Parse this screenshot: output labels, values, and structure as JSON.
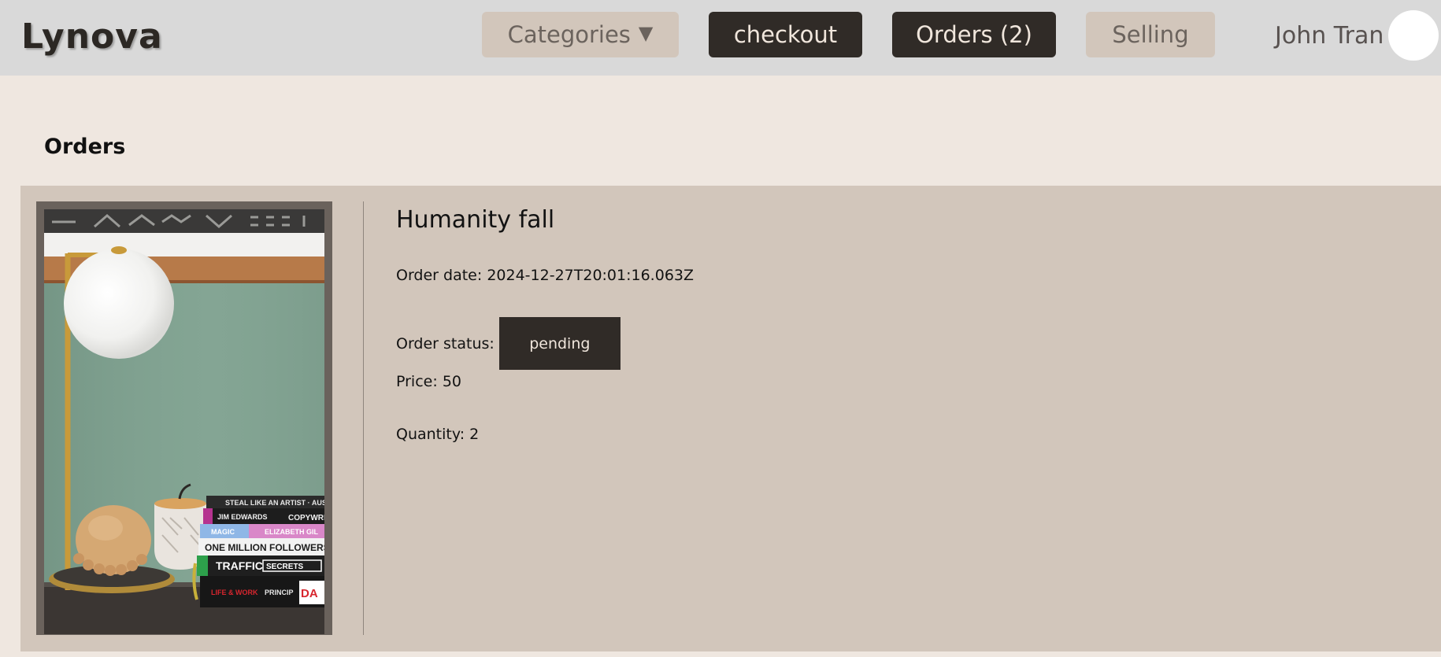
{
  "header": {
    "brand": "Lynova",
    "nav": {
      "categories_label": "Categories",
      "categories_caret": "▼",
      "checkout_label": "checkout",
      "orders_label": "Orders (2)",
      "selling_label": "Selling"
    },
    "user_name": "John Tran"
  },
  "main": {
    "title": "Orders",
    "orders": [
      {
        "name": "Humanity fall",
        "order_date_label": "Order date:",
        "order_date": "2024-12-27T20:01:16.063Z",
        "status_label": "Order status:",
        "status": "pending",
        "price_label": "Price:",
        "price": "50",
        "quantity_label": "Quantity:",
        "quantity": "2",
        "image": {
          "subject": "desk lamp with globe shade, decorative bowls and stack of books",
          "book_spines": [
            "STEAL LIKE AN ARTIST",
            "JIM EDWARDS COPYWRI",
            "ELIZABETH GIL",
            "ONE MILLION FOLLOWERS",
            "TRAFFIC SECRETS",
            "LIFE & WORK PRINCIP DA"
          ]
        }
      }
    ]
  },
  "colors": {
    "header_bg": "#d9d9d9",
    "page_bg": "#efe7e0",
    "card_bg": "#d2c6bb",
    "dark_button": "#302b27",
    "light_button": "#d2c6bb",
    "frame": "#6a625c"
  }
}
